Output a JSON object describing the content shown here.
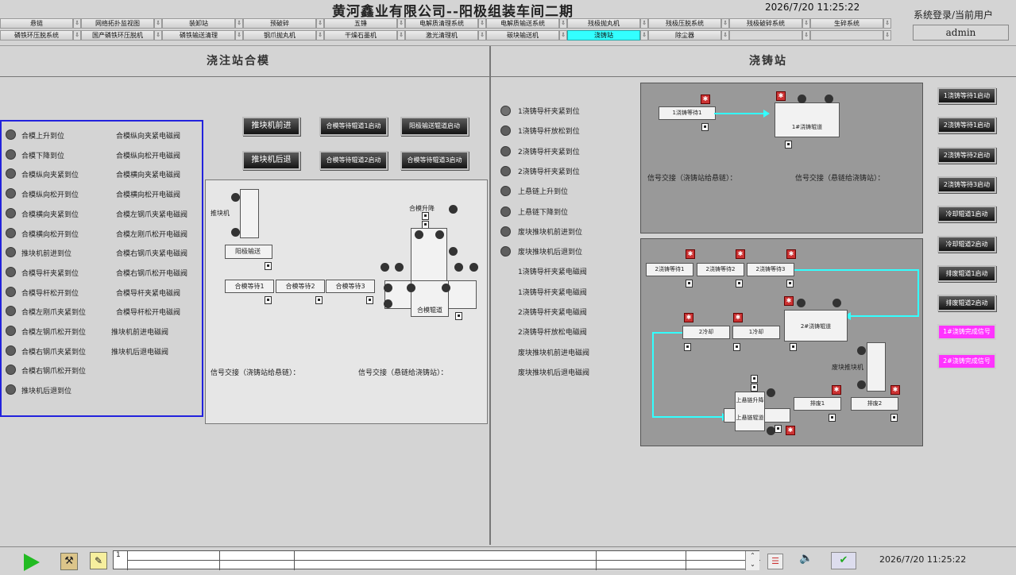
{
  "header": {
    "title": "黄河鑫业有限公司--阳极组装车间二期",
    "datetime": "2026/7/20 11:25:22",
    "login_label": "系统登录/当前用户",
    "user": "admin"
  },
  "nav": {
    "row1": [
      "悬链",
      "网络拓扑监视图",
      "装卸站",
      "预破碎",
      "五锤",
      "电解质清理系统",
      "电解质输送系统",
      "残极抛丸机",
      "残极压脱系统",
      "残极破碎系统",
      "生碎系统"
    ],
    "row2": [
      "磷铁环压脱系统",
      "国产磷铁环压脱机",
      "磷铁输送清理",
      "钢爪抛丸机",
      "干燥石墨机",
      "激光清理机",
      "碳块输送机",
      "浇铸站",
      "除尘器",
      "",
      ""
    ],
    "active": "浇铸站"
  },
  "left": {
    "title": "浇注站合模",
    "status": [
      "合模上升到位",
      "合模下降到位",
      "合模纵向夹紧到位",
      "合模纵向松开到位",
      "合模横向夹紧到位",
      "合模横向松开到位",
      "推块机前进到位",
      "合模导杆夹紧到位",
      "合模导杆松开到位",
      "合模左刚爪夹紧到位",
      "合模左钢爪松开到位",
      "合模右钢爪夹紧到位",
      "合模右钢爪松开到位",
      "推块机后退到位"
    ],
    "valves": [
      "合模纵向夹紧电磁阀",
      "合模纵向松开电磁阀",
      "合模横向夹紧电磁阀",
      "合模横向松开电磁阀",
      "合模左钢爪夹紧电磁阀",
      "合模左刚爪松开电磁阀",
      "合模右钢爪夹紧电磁阀",
      "合模右钢爪松开电磁阀",
      "合模导杆夹紧电磁阀",
      "合模导杆松开电磁阀",
      "推块机前进电磁阀",
      "推块机后退电磁阀"
    ],
    "buttons": {
      "push_fwd": "推块机前进",
      "push_back": "推块机后退",
      "roll1": "合模等待辊道1启动",
      "roll2": "合模等待辊道2启动",
      "anode": "阳极输送辊道启动",
      "roll3": "合模等待辊道3启动"
    },
    "diagram": {
      "pusher": "推块机",
      "anode_conv": "阳极输送",
      "wait1": "合模等待1",
      "wait2": "合模等待2",
      "wait3": "合模等待3",
      "lift": "合模升降",
      "roller": "合模辊道",
      "sig1": "信号交接（浇铸站给悬链）：",
      "sig2": "信号交接（悬链给浇铸站）："
    }
  },
  "right": {
    "title": "浇铸站",
    "status": [
      "1浇铸导杆夹紧到位",
      "1浇铸导杆放松到位",
      "2浇铸导杆夹紧到位",
      "2浇铸导杆夹紧到位",
      "上悬链上升到位",
      "上悬链下降到位",
      "废块推块机前进到位",
      "废块推块机后退到位"
    ],
    "valves": [
      "1浇铸导杆夹紧电磁阀",
      "1浇铸导杆夹紧电磁阀",
      "2浇铸导杆夹紧电磁阀",
      "2浇铸导杆放松电磁阀",
      "废块推块机前进电磁阀",
      "废块推块机后退电磁阀"
    ],
    "top_diagram": {
      "wait1": "1浇铸等待1",
      "cast1": "1#浇铸辊道",
      "sig1": "信号交接（浇铸站给悬链）：",
      "sig2": "信号交接（悬链给浇铸站）："
    },
    "bottom_diagram": {
      "wait1": "2浇铸等待1",
      "wait2": "2浇铸等待2",
      "wait3": "2浇铸等待3",
      "cool2": "2冷却",
      "cool1": "1冷却",
      "cast2": "2#浇铸辊道",
      "pusher": "废块推块机",
      "lift": "上悬链升降",
      "roller": "上悬链辊道",
      "waste1": "排废1",
      "waste2": "排废2"
    },
    "buttons": [
      "1浇铸等待1启动",
      "2浇铸等待1启动",
      "2浇铸等待2启动",
      "2浇铸等待3启动",
      "冷却辊道1启动",
      "冷却辊道2启动",
      "排废辊道1启动",
      "排废辊道2启动"
    ],
    "pink_buttons": [
      "1#浇铸完成信号",
      "2#浇铸完成信号"
    ]
  },
  "bottom": {
    "row_num": "1",
    "datetime": "2026/7/20 11:25:22"
  },
  "colors": {
    "accent": "#33ffff",
    "pink": "#ff33ff",
    "panel": "#999999",
    "led": "#5e5e5e"
  }
}
